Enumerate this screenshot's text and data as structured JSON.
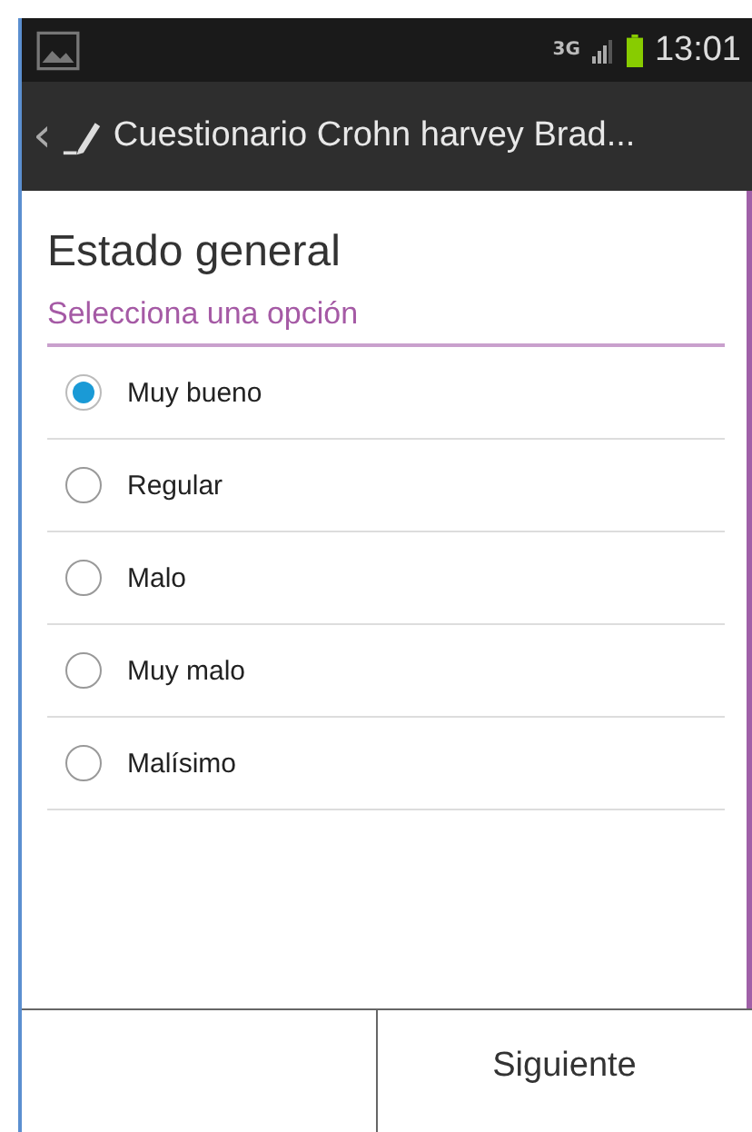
{
  "status_bar": {
    "network": "3G",
    "time": "13:01"
  },
  "action_bar": {
    "back": "‹",
    "title": "Cuestionario Crohn harvey Brad..."
  },
  "question": {
    "title": "Estado general",
    "hint": "Selecciona una opción"
  },
  "options": [
    {
      "label": "Muy bueno",
      "selected": true
    },
    {
      "label": "Regular",
      "selected": false
    },
    {
      "label": "Malo",
      "selected": false
    },
    {
      "label": "Muy malo",
      "selected": false
    },
    {
      "label": "Malísimo",
      "selected": false
    }
  ],
  "buttons": [
    {
      "label": "Siguiente"
    }
  ]
}
